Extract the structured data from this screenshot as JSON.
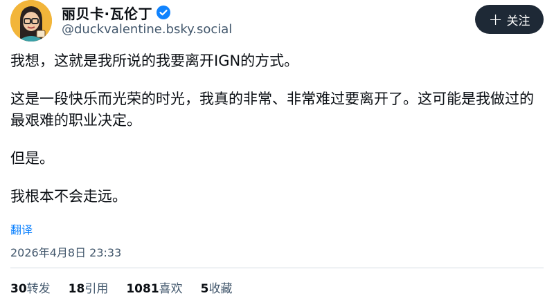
{
  "author": {
    "display_name": "丽贝卡·瓦伦丁",
    "handle": "@duckvalentine.bsky.social",
    "verified_color": "#1083fe"
  },
  "follow_button": {
    "label": "关注"
  },
  "post": {
    "paragraphs": [
      "我想，这就是我所说的我要离开IGN的方式。",
      "这是一段快乐而光荣的时光，我真的非常、非常难过要离开了。这可能是我做过的最艰难的职业决定。",
      "但是。",
      "我根本不会走远。"
    ],
    "translate_label": "翻译",
    "timestamp": "2026年4月8日 23:33"
  },
  "stats": {
    "reposts": {
      "count": "30",
      "label": "转发"
    },
    "quotes": {
      "count": "18",
      "label": "引用"
    },
    "likes": {
      "count": "1081",
      "label": "喜欢"
    },
    "saves": {
      "count": "5",
      "label": "收藏"
    }
  },
  "colors": {
    "accent": "#1083fe",
    "button_bg": "#1e2936",
    "muted_text": "#42576c"
  }
}
